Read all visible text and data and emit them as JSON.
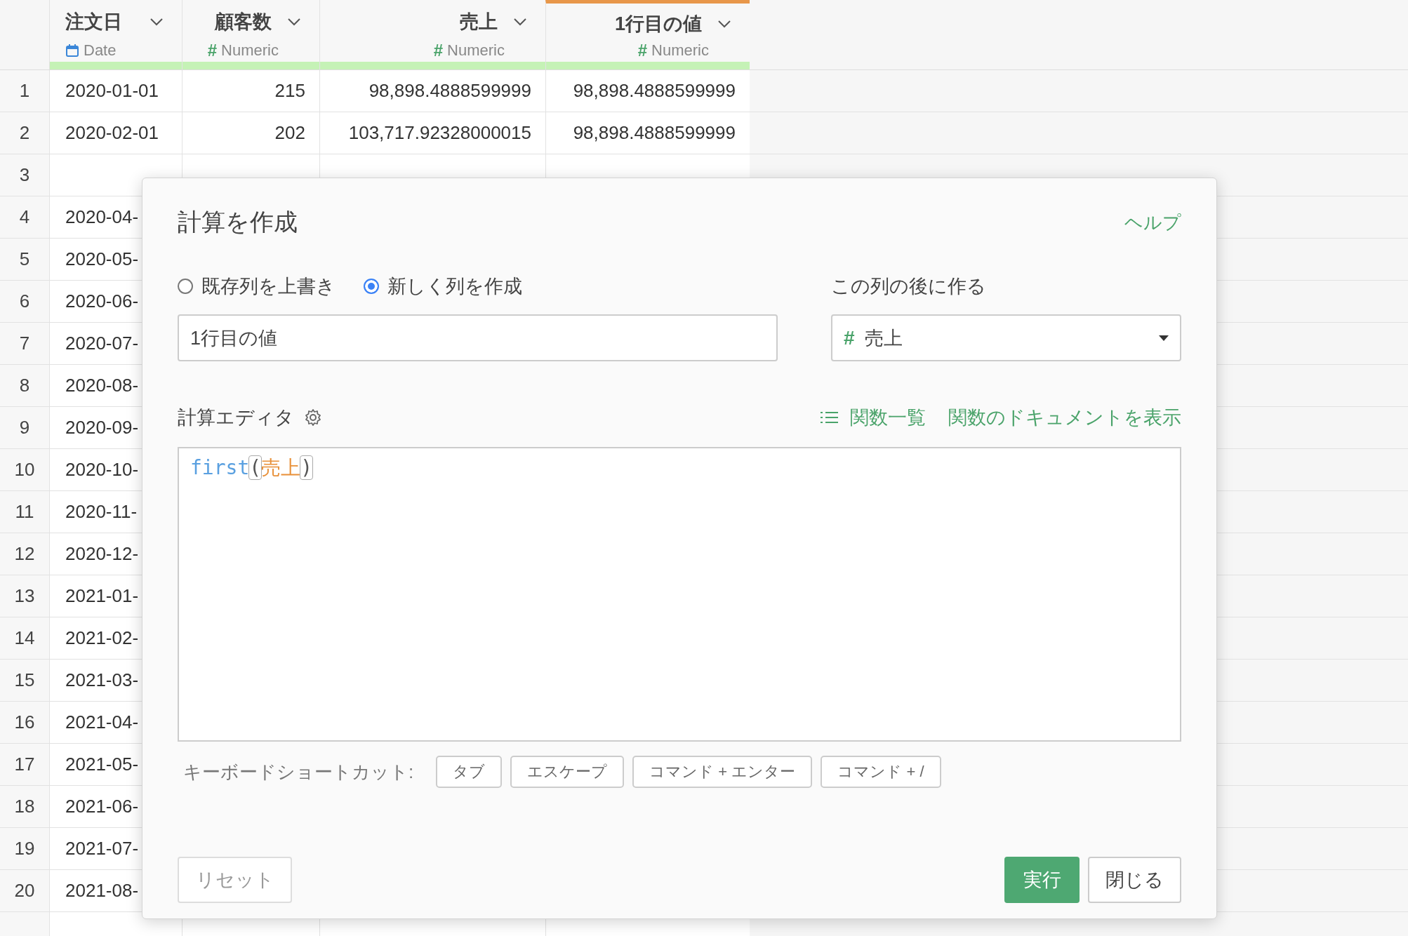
{
  "table": {
    "columns": [
      {
        "title": "注文日",
        "kind": "date",
        "type_label": "Date",
        "selected": false
      },
      {
        "title": "顧客数",
        "kind": "numeric",
        "symbol": "#",
        "type_label": "Numeric",
        "selected": false
      },
      {
        "title": "売上",
        "kind": "numeric",
        "symbol": "#",
        "type_label": "Numeric",
        "selected": false
      },
      {
        "title": "1行目の値",
        "kind": "numeric",
        "symbol": "#",
        "type_label": "Numeric",
        "selected": true
      }
    ],
    "rows": [
      {
        "number": "1",
        "cells": [
          "2020-01-01",
          "215",
          "98,898.4888599999",
          "98,898.4888599999"
        ]
      },
      {
        "number": "2",
        "cells": [
          "2020-02-01",
          "202",
          "103,717.92328000015",
          "98,898.4888599999"
        ]
      },
      {
        "number": "3",
        "cells": []
      },
      {
        "number": "4",
        "cells": [
          "2020-04-"
        ]
      },
      {
        "number": "5",
        "cells": [
          "2020-05-"
        ]
      },
      {
        "number": "6",
        "cells": [
          "2020-06-"
        ]
      },
      {
        "number": "7",
        "cells": [
          "2020-07-"
        ]
      },
      {
        "number": "8",
        "cells": [
          "2020-08-"
        ]
      },
      {
        "number": "9",
        "cells": [
          "2020-09-"
        ]
      },
      {
        "number": "10",
        "cells": [
          "2020-10-"
        ]
      },
      {
        "number": "11",
        "cells": [
          "2020-11-"
        ]
      },
      {
        "number": "12",
        "cells": [
          "2020-12-"
        ]
      },
      {
        "number": "13",
        "cells": [
          "2021-01-"
        ]
      },
      {
        "number": "14",
        "cells": [
          "2021-02-"
        ]
      },
      {
        "number": "15",
        "cells": [
          "2021-03-"
        ]
      },
      {
        "number": "16",
        "cells": [
          "2021-04-"
        ]
      },
      {
        "number": "17",
        "cells": [
          "2021-05-"
        ]
      },
      {
        "number": "18",
        "cells": [
          "2021-06-"
        ]
      },
      {
        "number": "19",
        "cells": [
          "2021-07-"
        ]
      },
      {
        "number": "20",
        "cells": [
          "2021-08-"
        ]
      }
    ]
  },
  "dialog": {
    "title": "計算を作成",
    "help_link": "ヘルプ",
    "mode_options": [
      {
        "label": "既存列を上書き",
        "selected": false
      },
      {
        "label": "新しく列を作成",
        "selected": true
      }
    ],
    "column_name": {
      "value": "1行目の値"
    },
    "insert_after": {
      "label": "この列の後に作る",
      "symbol": "#",
      "value": "売上"
    },
    "editor": {
      "label": "計算エディタ",
      "function_list_link": "関数一覧",
      "docs_link": "関数のドキュメントを表示",
      "tokens": [
        {
          "kind": "function",
          "text": "first"
        },
        {
          "kind": "paren",
          "text": "("
        },
        {
          "kind": "column",
          "text": "売上"
        },
        {
          "kind": "paren",
          "text": ")"
        }
      ]
    },
    "shortcuts": {
      "label": "キーボードショートカット:",
      "keys": [
        "タブ",
        "エスケープ",
        "コマンド + エンター",
        "コマンド + /"
      ]
    },
    "buttons": {
      "reset": "リセット",
      "run": "実行",
      "close": "閉じる"
    }
  }
}
